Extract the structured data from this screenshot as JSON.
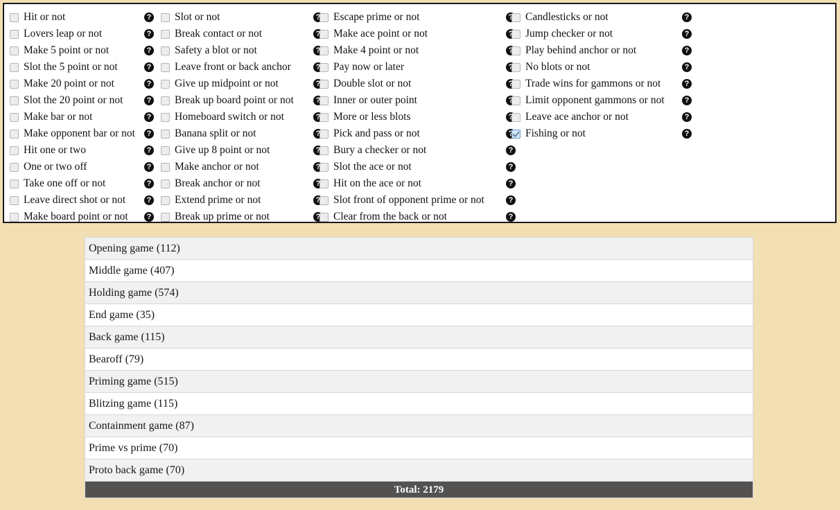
{
  "theme": {
    "page_background": "#f3dfb4",
    "panel_background": "#ffffff",
    "panel_border": "#1a1a1a",
    "row_alt_background": "#f1f1f1",
    "total_bar_background": "#545251",
    "total_bar_text": "#ffffff",
    "checked_checkbox": "#cfe3f7"
  },
  "filters": {
    "help_icon": "question-mark-icon",
    "columns": [
      {
        "items": [
          {
            "label": "Hit or not",
            "checked": false
          },
          {
            "label": "Lovers leap or not",
            "checked": false
          },
          {
            "label": "Make 5 point or not",
            "checked": false
          },
          {
            "label": "Slot the 5 point or not",
            "checked": false
          },
          {
            "label": "Make 20 point or not",
            "checked": false
          },
          {
            "label": "Slot the 20 point or not",
            "checked": false
          },
          {
            "label": "Make bar or not",
            "checked": false
          },
          {
            "label": "Make opponent bar or not",
            "checked": false
          },
          {
            "label": "Hit one or two",
            "checked": false
          },
          {
            "label": "One or two off",
            "checked": false
          },
          {
            "label": "Take one off or not",
            "checked": false
          },
          {
            "label": "Leave direct shot or not",
            "checked": false
          },
          {
            "label": "Make board point or not",
            "checked": false
          }
        ]
      },
      {
        "items": [
          {
            "label": "Slot or not",
            "checked": false
          },
          {
            "label": "Break contact or not",
            "checked": false
          },
          {
            "label": "Safety a blot or not",
            "checked": false
          },
          {
            "label": "Leave front or back anchor",
            "checked": false
          },
          {
            "label": "Give up midpoint or not",
            "checked": false
          },
          {
            "label": "Break up board point or not",
            "checked": false
          },
          {
            "label": "Homeboard switch or not",
            "checked": false
          },
          {
            "label": "Banana split or not",
            "checked": false
          },
          {
            "label": "Give up 8 point or not",
            "checked": false
          },
          {
            "label": "Make anchor or not",
            "checked": false
          },
          {
            "label": "Break anchor or not",
            "checked": false
          },
          {
            "label": "Extend prime or not",
            "checked": false
          },
          {
            "label": "Break up prime or not",
            "checked": false
          }
        ]
      },
      {
        "items": [
          {
            "label": "Escape prime or not",
            "checked": false
          },
          {
            "label": "Make ace point or not",
            "checked": false
          },
          {
            "label": "Make 4 point or not",
            "checked": false
          },
          {
            "label": "Pay now or later",
            "checked": false
          },
          {
            "label": "Double slot or not",
            "checked": false
          },
          {
            "label": "Inner or outer point",
            "checked": false
          },
          {
            "label": "More or less blots",
            "checked": false
          },
          {
            "label": "Pick and pass or not",
            "checked": false
          },
          {
            "label": "Bury a checker or not",
            "checked": false
          },
          {
            "label": "Slot the ace or not",
            "checked": false
          },
          {
            "label": "Hit on the ace or not",
            "checked": false
          },
          {
            "label": "Slot front of opponent prime or not",
            "checked": false
          },
          {
            "label": "Clear from the back or not",
            "checked": false
          }
        ]
      },
      {
        "items": [
          {
            "label": "Candlesticks or not",
            "checked": false
          },
          {
            "label": "Jump checker or not",
            "checked": false
          },
          {
            "label": "Play behind anchor or not",
            "checked": false
          },
          {
            "label": "No blots or not",
            "checked": false
          },
          {
            "label": "Trade wins for gammons or not",
            "checked": false
          },
          {
            "label": "Limit opponent gammons or not",
            "checked": false
          },
          {
            "label": "Leave ace anchor or not",
            "checked": false
          },
          {
            "label": "Fishing or not",
            "checked": true
          }
        ]
      }
    ]
  },
  "game_list": {
    "items": [
      {
        "label": "Opening game (112)",
        "name": "Opening game",
        "count": 112
      },
      {
        "label": "Middle game (407)",
        "name": "Middle game",
        "count": 407
      },
      {
        "label": "Holding game (574)",
        "name": "Holding game",
        "count": 574
      },
      {
        "label": "End game (35)",
        "name": "End game",
        "count": 35
      },
      {
        "label": "Back game (115)",
        "name": "Back game",
        "count": 115
      },
      {
        "label": "Bearoff (79)",
        "name": "Bearoff",
        "count": 79
      },
      {
        "label": "Priming game (515)",
        "name": "Priming game",
        "count": 515
      },
      {
        "label": "Blitzing game (115)",
        "name": "Blitzing game",
        "count": 115
      },
      {
        "label": "Containment game (87)",
        "name": "Containment game",
        "count": 87
      },
      {
        "label": "Prime vs prime (70)",
        "name": "Prime vs prime",
        "count": 70
      },
      {
        "label": "Proto back game (70)",
        "name": "Proto back game",
        "count": 70
      }
    ],
    "total_label": "Total: 2179"
  }
}
